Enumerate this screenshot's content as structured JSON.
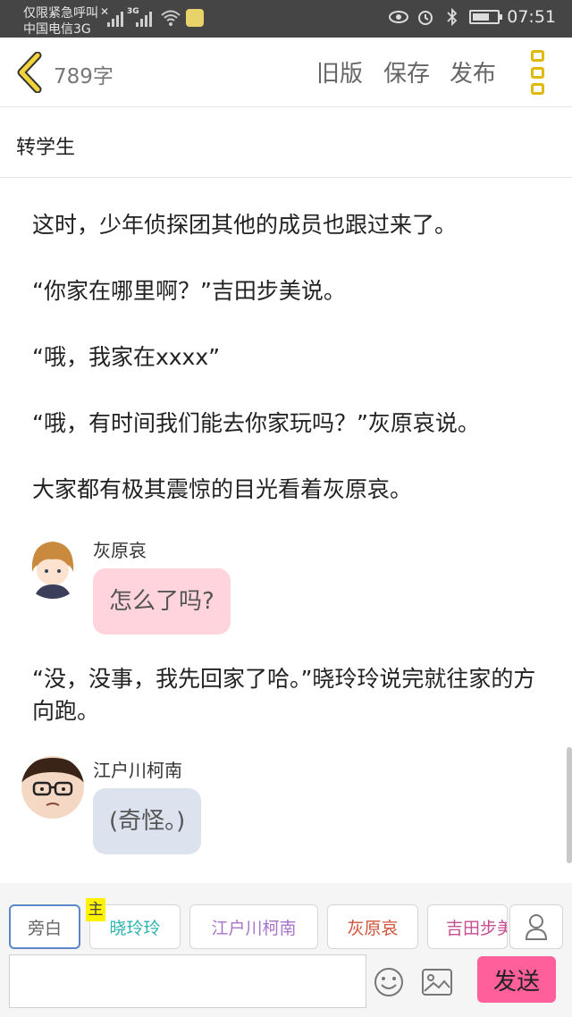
{
  "status_bar": {
    "carrier_line1": "仅限紧急呼叫",
    "carrier_line2": "中国电信3G",
    "network_type": "3G",
    "time": "07:51",
    "icons": [
      "signal-icon",
      "wifi-icon",
      "app-notification-icon",
      "eye-icon",
      "alarm-icon",
      "bluetooth-icon",
      "battery-icon"
    ]
  },
  "app_bar": {
    "word_count": "789字",
    "old_version_label": "旧版",
    "save_label": "保存",
    "publish_label": "发布",
    "accent_color": "#e0b90a"
  },
  "story": {
    "title": "转学生"
  },
  "content": {
    "paragraphs": [
      "这时，少年侦探团其他的成员也跟过来了。",
      "“你家在哪里啊？”吉田步美说。",
      "“哦，我家在xxxx”",
      "“哦，有时间我们能去你家玩吗？”灰原哀说。",
      "大家都有极其震惊的目光看着灰原哀。"
    ],
    "chat1": {
      "speaker": "灰原哀",
      "message": "怎么了吗?"
    },
    "paragraph_after": "“没，没事，我先回家了哈。”晓玲玲说完就往家的方向跑。",
    "chat2": {
      "speaker": "江户川柯南",
      "message": "(奇怪。)"
    }
  },
  "bottom_bar": {
    "main_badge": "主",
    "roles": [
      {
        "label": "旁白",
        "color": "#666666"
      },
      {
        "label": "晓玲玲",
        "color": "#2bb3b0"
      },
      {
        "label": "江户川柯南",
        "color": "#a874c8"
      },
      {
        "label": "灰原哀",
        "color": "#d0533b"
      },
      {
        "label": "吉田步美",
        "color": "#c64d8e"
      }
    ],
    "input_placeholder": "",
    "send_label": "发送",
    "send_color": "#ff5f9a"
  }
}
